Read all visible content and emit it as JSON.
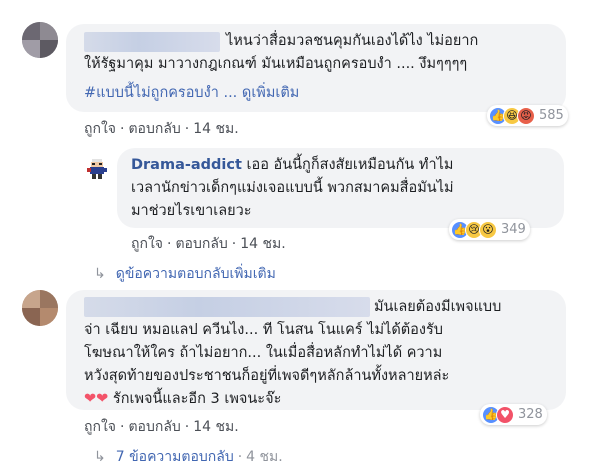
{
  "comments": [
    {
      "text_line1": "ไหนว่าสื่อมวลชนคุมกันเองได้ไง ไม่อยาก",
      "text_line2": "ให้รัฐมาคุม มาวางกฎเกณฑ์ มันเหมือนถูกครอบงำ .... งึมๆๆๆๆ",
      "hashtag": "#แบบนี้ไม่ถูกครอบงำ",
      "see_more": "... ดูเพิ่มเติม",
      "like_label": "ถูกใจ",
      "reply_label": "ตอบกลับ",
      "time": "14 ชม.",
      "reaction_count": "585"
    },
    {
      "author": "Drama-addict",
      "text_line1": "เออ อันนี้กูก็สงสัยเหมือนกัน ทำไม",
      "text_line2": "เวลานักข่าวเด็กๆแม่งเจอแบบนี้ พวกสมาคมสื่อมันไม่",
      "text_line3": "มาช่วยไรเขาเลยวะ",
      "like_label": "ถูกใจ",
      "reply_label": "ตอบกลับ",
      "time": "14 ชม.",
      "reaction_count": "349"
    },
    {
      "text_line1": "มันเลยต้องมีเพจแบบ",
      "text_line2": "จ่า เฉียบ หมอแลป ควีนไง... ที โนสน โนแคร์ ไม่ได้ต้องรับ",
      "text_line3": "โฆษณาให้ใคร ถ้าไม่อยาก... ในเมื่อสื่อหลักทำไม่ได้ ความ",
      "text_line4": "หวังสุดท้ายของประชาชนก็อยู่ที่เพจดีๆหลักล้านทั้งหลายหล่ะ",
      "text_line5": "รักเพจนี้และอีก 3 เพจนะจ๊ะ",
      "like_label": "ถูกใจ",
      "reply_label": "ตอบกลับ",
      "time": "14 ชม.",
      "reaction_count": "328"
    }
  ],
  "view_more_replies": "ดูข้อความตอบกลับเพิ่มเติม",
  "more_replies": {
    "label": "7 ข้อความตอบกลับ",
    "time": "4 ชม."
  },
  "separator": "·",
  "colors": {
    "bubble": "#f2f3f5",
    "link": "#4267b2",
    "author": "#365899",
    "meta": "#90949c"
  }
}
